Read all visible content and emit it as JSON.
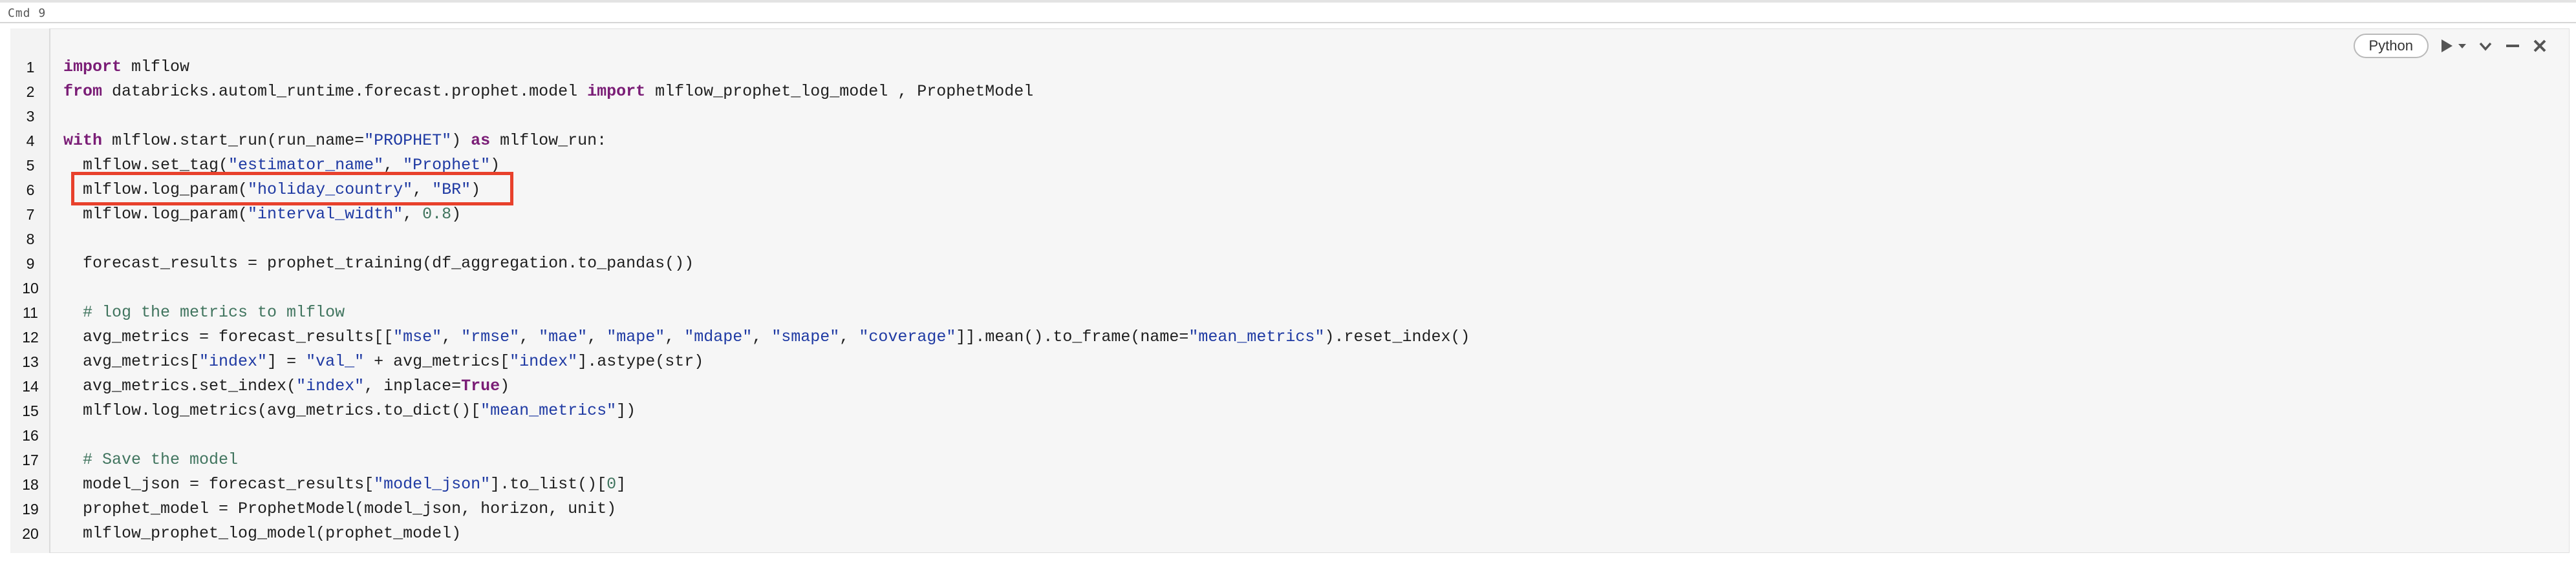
{
  "cell": {
    "command_label": "Cmd 9",
    "language": "Python",
    "icons": {
      "run": "play-icon",
      "run_menu": "caret-down-icon",
      "collapse": "chevron-down-icon",
      "minimize": "minus-icon",
      "close": "close-icon"
    }
  },
  "colors": {
    "keyword": "#7a1d76",
    "string": "#1f3aa3",
    "comment": "#41755f",
    "highlight_box": "#e8412c"
  },
  "code_lines": [
    {
      "n": "1",
      "tokens": [
        [
          "kw",
          "import"
        ],
        [
          "t",
          " mlflow"
        ]
      ]
    },
    {
      "n": "2",
      "tokens": [
        [
          "kw",
          "from"
        ],
        [
          "t",
          " databricks.automl_runtime.forecast.prophet.model "
        ],
        [
          "kw",
          "import"
        ],
        [
          "t",
          " mlflow_prophet_log_model , ProphetModel"
        ]
      ]
    },
    {
      "n": "3",
      "tokens": []
    },
    {
      "n": "4",
      "tokens": [
        [
          "kw",
          "with"
        ],
        [
          "t",
          " mlflow.start_run(run_name="
        ],
        [
          "str",
          "\"PROPHET\""
        ],
        [
          "t",
          ") "
        ],
        [
          "kw",
          "as"
        ],
        [
          "t",
          " mlflow_run:"
        ]
      ]
    },
    {
      "n": "5",
      "tokens": [
        [
          "t",
          "  mlflow.set_tag("
        ],
        [
          "str",
          "\"estimator_name\""
        ],
        [
          "t",
          ", "
        ],
        [
          "str",
          "\"Prophet\""
        ],
        [
          "t",
          ")"
        ]
      ]
    },
    {
      "n": "6",
      "tokens": [
        [
          "t",
          "  mlflow.log_param("
        ],
        [
          "str",
          "\"holiday_country\""
        ],
        [
          "t",
          ", "
        ],
        [
          "str",
          "\"BR\""
        ],
        [
          "t",
          ")"
        ]
      ]
    },
    {
      "n": "7",
      "tokens": [
        [
          "t",
          "  mlflow.log_param("
        ],
        [
          "str",
          "\"interval_width\""
        ],
        [
          "t",
          ", "
        ],
        [
          "num",
          "0.8"
        ],
        [
          "t",
          ")"
        ]
      ]
    },
    {
      "n": "8",
      "tokens": []
    },
    {
      "n": "9",
      "tokens": [
        [
          "t",
          "  forecast_results = prophet_training(df_aggregation.to_pandas())"
        ]
      ]
    },
    {
      "n": "10",
      "tokens": []
    },
    {
      "n": "11",
      "tokens": [
        [
          "cm",
          "  # log the metrics to mlflow"
        ]
      ]
    },
    {
      "n": "12",
      "tokens": [
        [
          "t",
          "  avg_metrics = forecast_results[["
        ],
        [
          "str",
          "\"mse\""
        ],
        [
          "t",
          ", "
        ],
        [
          "str",
          "\"rmse\""
        ],
        [
          "t",
          ", "
        ],
        [
          "str",
          "\"mae\""
        ],
        [
          "t",
          ", "
        ],
        [
          "str",
          "\"mape\""
        ],
        [
          "t",
          ", "
        ],
        [
          "str",
          "\"mdape\""
        ],
        [
          "t",
          ", "
        ],
        [
          "str",
          "\"smape\""
        ],
        [
          "t",
          ", "
        ],
        [
          "str",
          "\"coverage\""
        ],
        [
          "t",
          "]].mean().to_frame(name="
        ],
        [
          "str",
          "\"mean_metrics\""
        ],
        [
          "t",
          ").reset_index()"
        ]
      ]
    },
    {
      "n": "13",
      "tokens": [
        [
          "t",
          "  avg_metrics["
        ],
        [
          "str",
          "\"index\""
        ],
        [
          "t",
          "] = "
        ],
        [
          "str",
          "\"val_\""
        ],
        [
          "t",
          " + avg_metrics["
        ],
        [
          "str",
          "\"index\""
        ],
        [
          "t",
          "].astype(str)"
        ]
      ]
    },
    {
      "n": "14",
      "tokens": [
        [
          "t",
          "  avg_metrics.set_index("
        ],
        [
          "str",
          "\"index\""
        ],
        [
          "t",
          ", inplace="
        ],
        [
          "kw",
          "True"
        ],
        [
          "t",
          ")"
        ]
      ]
    },
    {
      "n": "15",
      "tokens": [
        [
          "t",
          "  mlflow.log_metrics(avg_metrics.to_dict()["
        ],
        [
          "str",
          "\"mean_metrics\""
        ],
        [
          "t",
          "])"
        ]
      ]
    },
    {
      "n": "16",
      "tokens": []
    },
    {
      "n": "17",
      "tokens": [
        [
          "cm",
          "  # Save the model"
        ]
      ]
    },
    {
      "n": "18",
      "tokens": [
        [
          "t",
          "  model_json = forecast_results["
        ],
        [
          "str",
          "\"model_json\""
        ],
        [
          "t",
          "].to_list()["
        ],
        [
          "num",
          "0"
        ],
        [
          "t",
          "]"
        ]
      ]
    },
    {
      "n": "19",
      "tokens": [
        [
          "t",
          "  prophet_model = ProphetModel(model_json, horizon, unit)"
        ]
      ]
    },
    {
      "n": "20",
      "tokens": [
        [
          "t",
          "  mlflow_prophet_log_model(prophet_model)"
        ]
      ]
    }
  ]
}
